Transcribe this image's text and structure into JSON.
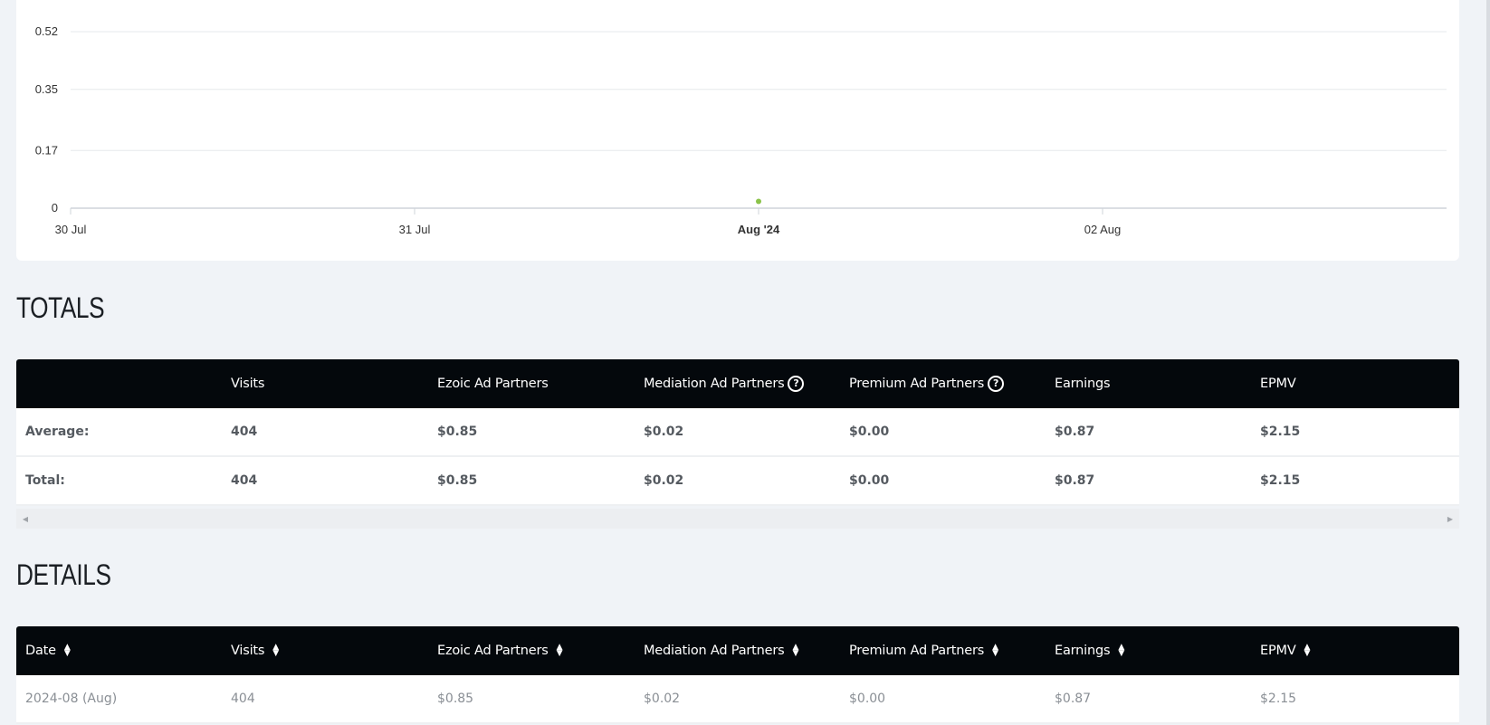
{
  "chart_data": {
    "type": "scatter",
    "title": "",
    "xlabel": "",
    "ylabel": "",
    "x_ticks": [
      "30 Jul",
      "31 Jul",
      "Aug '24",
      "02 Aug"
    ],
    "y_ticks": [
      "0",
      "0.17",
      "0.35",
      "0.52"
    ],
    "ylim": [
      0,
      0.52
    ],
    "xlim": [
      "2024-07-30",
      "2024-08-04"
    ],
    "grid": true,
    "series": [
      {
        "color": "#8bc34a",
        "points": [
          {
            "x": "2024-08-01",
            "y": 0.02
          }
        ]
      }
    ]
  },
  "totals": {
    "title": "TOTALS",
    "headers": [
      "",
      "Visits",
      "Ezoic Ad Partners",
      "Mediation Ad Partners",
      "Premium Ad Partners",
      "Earnings",
      "EPMV"
    ],
    "help_icon_glyph": "?",
    "rows": [
      [
        "Average:",
        "404",
        "$0.85",
        "$0.02",
        "$0.00",
        "$0.87",
        "$2.15"
      ],
      [
        "Total:",
        "404",
        "$0.85",
        "$0.02",
        "$0.00",
        "$0.87",
        "$2.15"
      ]
    ],
    "scroll_left_glyph": "◀",
    "scroll_right_glyph": "▶"
  },
  "details": {
    "title": "DETAILS",
    "headers": [
      "Date",
      "Visits",
      "Ezoic Ad Partners",
      "Mediation Ad Partners",
      "Premium Ad Partners",
      "Earnings",
      "EPMV"
    ],
    "sort_up_glyph": "▲",
    "sort_down_glyph": "▼",
    "rows": [
      [
        "2024-08 (Aug)",
        "404",
        "$0.85",
        "$0.02",
        "$0.00",
        "$0.87",
        "$2.15"
      ]
    ]
  },
  "colors": {
    "page_bg": "#f0f3f7",
    "header_bg": "#04080c",
    "point": "#8bc34a"
  }
}
